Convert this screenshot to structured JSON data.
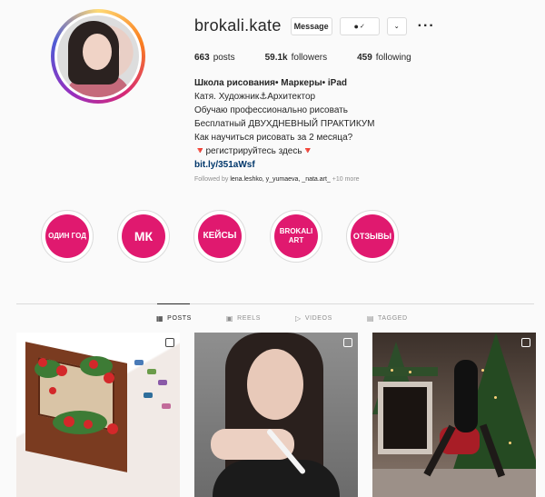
{
  "profile": {
    "username": "brokali.kate",
    "message_label": "Message",
    "follow_icon_label": "✓",
    "more_label": "···"
  },
  "stats": {
    "posts_value": "663",
    "posts_label": "posts",
    "followers_value": "59.1k",
    "followers_label": "followers",
    "following_value": "459",
    "following_label": "following"
  },
  "bio": {
    "name": "Школа рисования• Маркеры• iPad",
    "line1": "Катя. Художник⚓Архитектор",
    "line2": "Обучаю профессионально рисовать",
    "line3": "Бесплатный ДВУХДНЕВНЫЙ ПРАКТИКУМ",
    "line4": "Как научиться рисовать за 2 месяца?",
    "line5": "🔻регистрируйтесь здесь🔻",
    "link": "bit.ly/351aWsf"
  },
  "followed_by": {
    "prefix": "Followed by",
    "users": "lena.leshko, y_yumaeva, _nata.art_",
    "more": "+10 more"
  },
  "highlights": [
    {
      "label": "ОДИН ГОД"
    },
    {
      "label": "МК"
    },
    {
      "label": "КЕЙСЫ"
    },
    {
      "label": "BROKALI ART"
    },
    {
      "label": "ОТЗЫВЫ"
    }
  ],
  "tabs": [
    {
      "label": "POSTS",
      "icon": "grid-icon",
      "active": true
    },
    {
      "label": "REELS",
      "icon": "reels-icon",
      "active": false
    },
    {
      "label": "VIDEOS",
      "icon": "play-icon",
      "active": false
    },
    {
      "label": "TAGGED",
      "icon": "tag-icon",
      "active": false
    }
  ],
  "colors": {
    "highlight_bg": "#e0196f",
    "link": "#00376b",
    "muted": "#8e8e8e"
  }
}
